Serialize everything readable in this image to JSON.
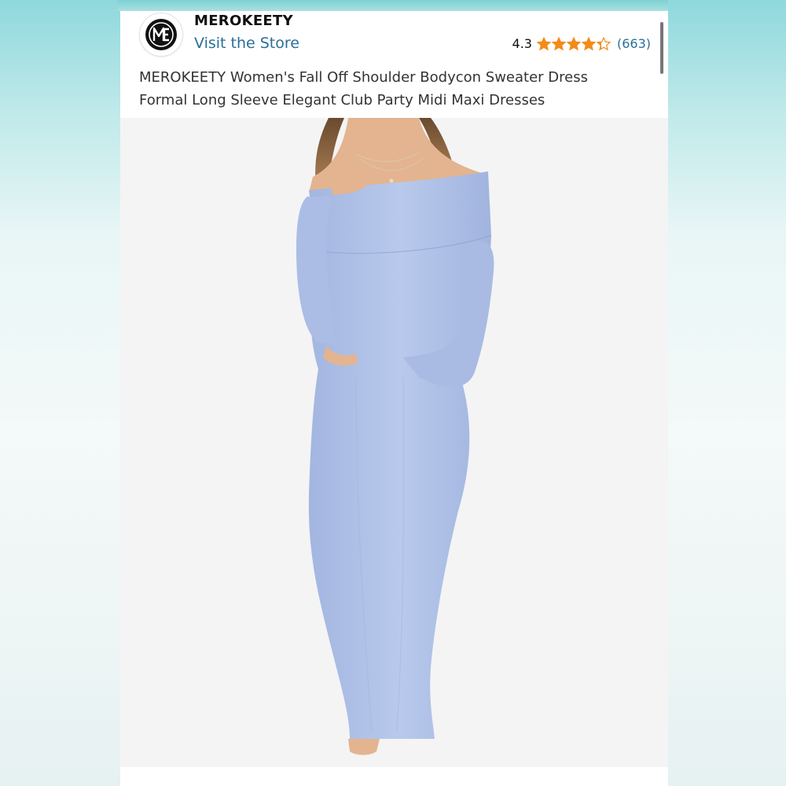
{
  "store": {
    "brand_name": "MEROKEETY",
    "visit_label": "Visit the Store"
  },
  "rating": {
    "value": "4.3",
    "stars_filled": 4.3,
    "star_color": "#f28c18",
    "review_count": "(663)"
  },
  "product": {
    "title_lines": [
      "MEROKEETY Women's Fall Off Shoulder Bodycon Sweater Dress",
      "Formal Long Sleeve Elegant Club Party Midi Maxi Dresses"
    ]
  },
  "colors": {
    "link": "#2a6f97",
    "dress": "#b2c3e8",
    "background_teal": "#8fd8dc"
  },
  "icons": {
    "logo": "brand-monogram-icon",
    "star": "star-icon",
    "half_star": "half-star-icon"
  }
}
